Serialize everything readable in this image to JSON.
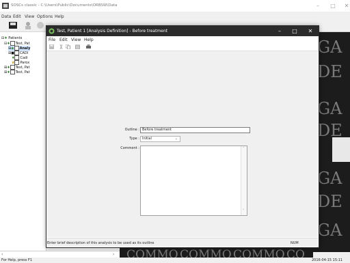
{
  "app": {
    "title": "SOSCs classic - C:\\Users\\Public\\Documents\\ORBSW\\Data",
    "menu": [
      "Data",
      "Edit",
      "View",
      "Options",
      "Help"
    ],
    "window_controls": {
      "minimize": "–",
      "maximize": "□",
      "close": "✕"
    }
  },
  "tree": {
    "items": [
      {
        "label": "Patients",
        "level": 0
      },
      {
        "label": "Test, Pat",
        "level": 1
      },
      {
        "label": "Analy",
        "level": 2
      },
      {
        "label": "CADI",
        "level": 2
      },
      {
        "label": "Cadi",
        "level": 2
      },
      {
        "label": "Parox",
        "level": 2
      },
      {
        "label": "Test, Pat",
        "level": 1
      },
      {
        "label": "Test, Pat",
        "level": 1
      }
    ]
  },
  "dialog": {
    "title": "Test, Patient 1 [Analysis Definition] - Before treatment",
    "menu": [
      "File",
      "Edit",
      "View",
      "Help"
    ],
    "window_controls": {
      "minimize": "–",
      "maximize": "□",
      "close": "✕"
    },
    "fields": {
      "outline": {
        "label": "Outline :",
        "value": "Before treatment"
      },
      "type": {
        "label": "Type :",
        "value": "Initial"
      },
      "comment": {
        "label": "Comment :",
        "value": ""
      }
    },
    "status": {
      "message": "Enter brief description of this analysis to be used as its outline",
      "indicator": "NUM"
    }
  },
  "status_bar": {
    "help": "For Help, press F1",
    "datetime": "2016-04-15   15:11"
  },
  "colors": {
    "dialog_titlebar": "#2b2b2b",
    "background": "#f0f0f0",
    "art_background": "#1c1c1c"
  }
}
